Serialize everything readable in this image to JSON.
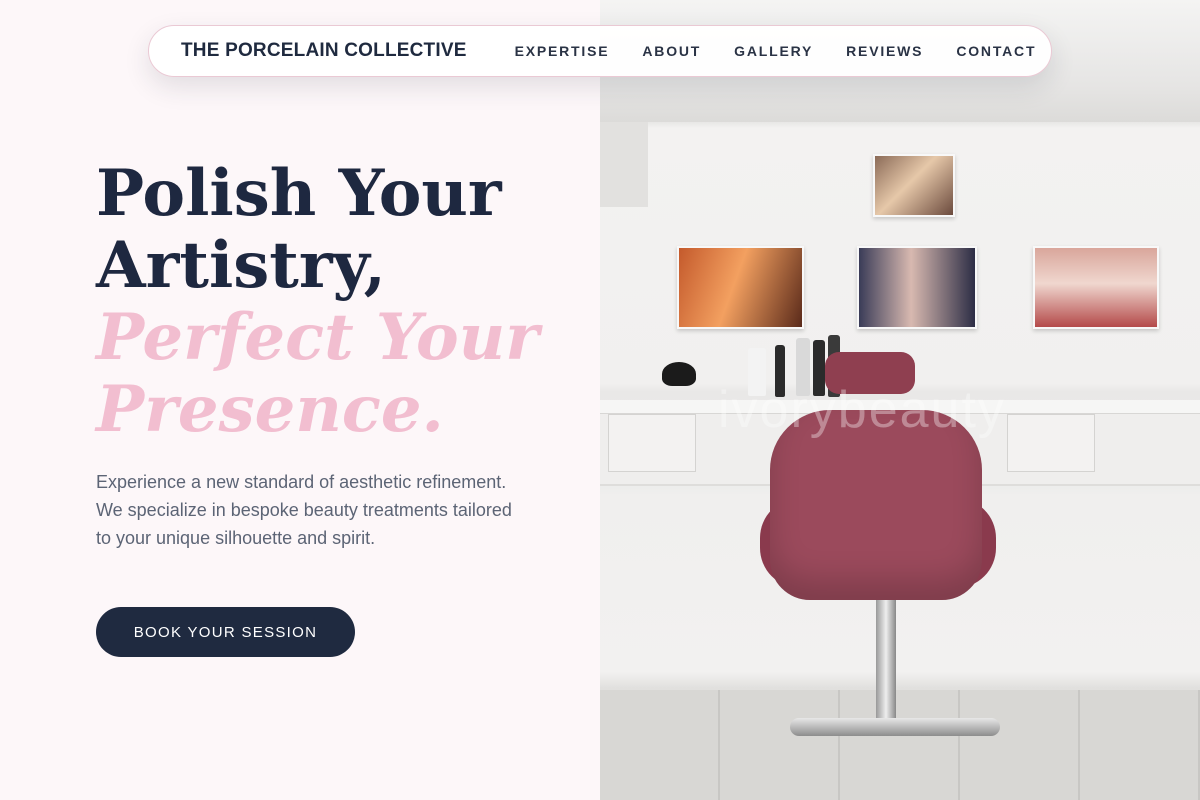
{
  "nav": {
    "brand": "THE PORCELAIN COLLECTIVE",
    "links": [
      "EXPERTISE",
      "ABOUT",
      "GALLERY",
      "REVIEWS",
      "CONTACT"
    ]
  },
  "hero": {
    "headline_line1": "Polish Your",
    "headline_line2": "Artistry,",
    "headline_accent1": "Perfect Your",
    "headline_accent2": "Presence.",
    "description": "Experience a new standard of aesthetic refinement. We specialize in bespoke beauty treatments tailored to your unique silhouette and spirit.",
    "cta_label": "BOOK YOUR SESSION"
  },
  "image": {
    "watermark": "ivorybeauty"
  },
  "colors": {
    "navy": "#1e2840",
    "accent_pink": "#f2bed0",
    "background": "#fdf7f9"
  }
}
